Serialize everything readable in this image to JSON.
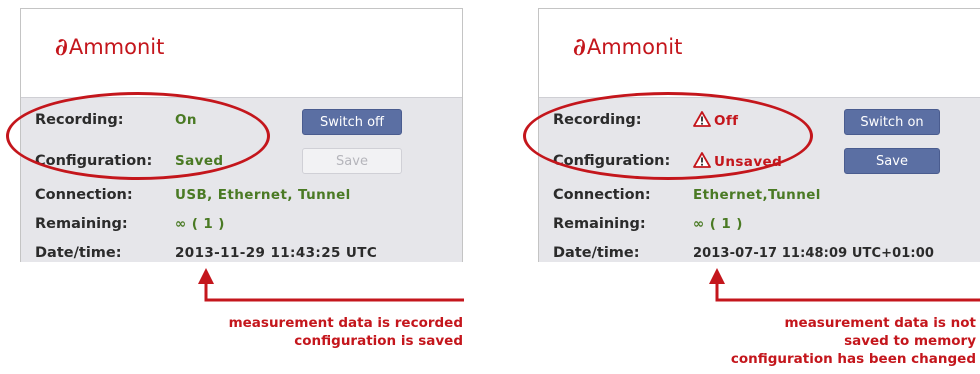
{
  "left_panel": {
    "logo_mark": "∂",
    "logo_text": "Ammonit",
    "rows": [
      {
        "label": "Recording:",
        "value": "On"
      },
      {
        "label": "Configuration:",
        "value": "Saved"
      },
      {
        "label": "Connection:",
        "value": "USB, Ethernet, Tunnel"
      },
      {
        "label": "Remaining:",
        "value": "∞ ( 1 )"
      },
      {
        "label": "Date/time:",
        "value": "2013-11-29 11:43:25 UTC"
      }
    ],
    "buttons": {
      "switch": "Switch off",
      "save": "Save"
    },
    "annotation": [
      "measurement data is recorded",
      "configuration is saved"
    ]
  },
  "right_panel": {
    "logo_mark": "∂",
    "logo_text": "Ammonit",
    "rows": [
      {
        "label": "Recording:",
        "value": "Off"
      },
      {
        "label": "Configuration:",
        "value": "Unsaved"
      },
      {
        "label": "Connection:",
        "value": "Ethernet,Tunnel"
      },
      {
        "label": "Remaining:",
        "value": "∞ ( 1 )"
      },
      {
        "label": "Date/time:",
        "value": "2013-07-17 11:48:09 UTC+01:00"
      }
    ],
    "buttons": {
      "switch": "Switch on",
      "save": "Save"
    },
    "annotation": [
      "measurement data is not",
      "saved to memory",
      "configuration has been changed"
    ]
  },
  "colors": {
    "accent_red": "#c4161c",
    "ok_green": "#4a7a24",
    "button_blue": "#5b6fa3"
  },
  "icons": [
    "warning-triangle-icon",
    "ammonit-logo-icon",
    "arrow-up-icon"
  ]
}
